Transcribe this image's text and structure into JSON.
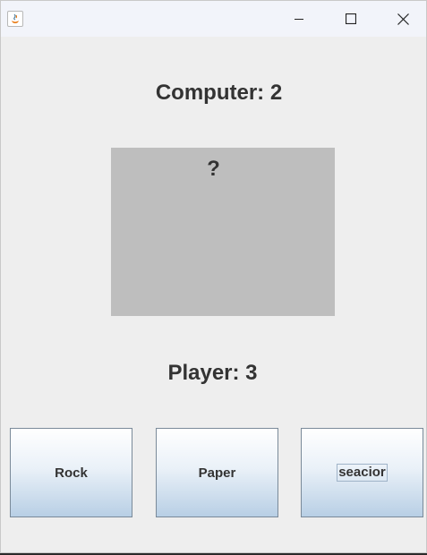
{
  "window": {
    "title": "",
    "controls": {
      "minimize_icon": "minimize-icon",
      "maximize_icon": "maximize-icon",
      "close_icon": "close-icon"
    }
  },
  "scoreboard": {
    "computer": "Computer: 2",
    "player": "Player: 3"
  },
  "computer_choice": {
    "display": "?",
    "panel_color": "#bebebe"
  },
  "buttons": [
    {
      "label": "Rock"
    },
    {
      "label": "Paper"
    },
    {
      "label": "seacior"
    }
  ],
  "colors": {
    "background": "#eeeeee",
    "titlebar": "#f2f4fa",
    "text": "#333333",
    "button_gradient_top": "#ffffff",
    "button_gradient_bottom": "#b8cfe5"
  }
}
